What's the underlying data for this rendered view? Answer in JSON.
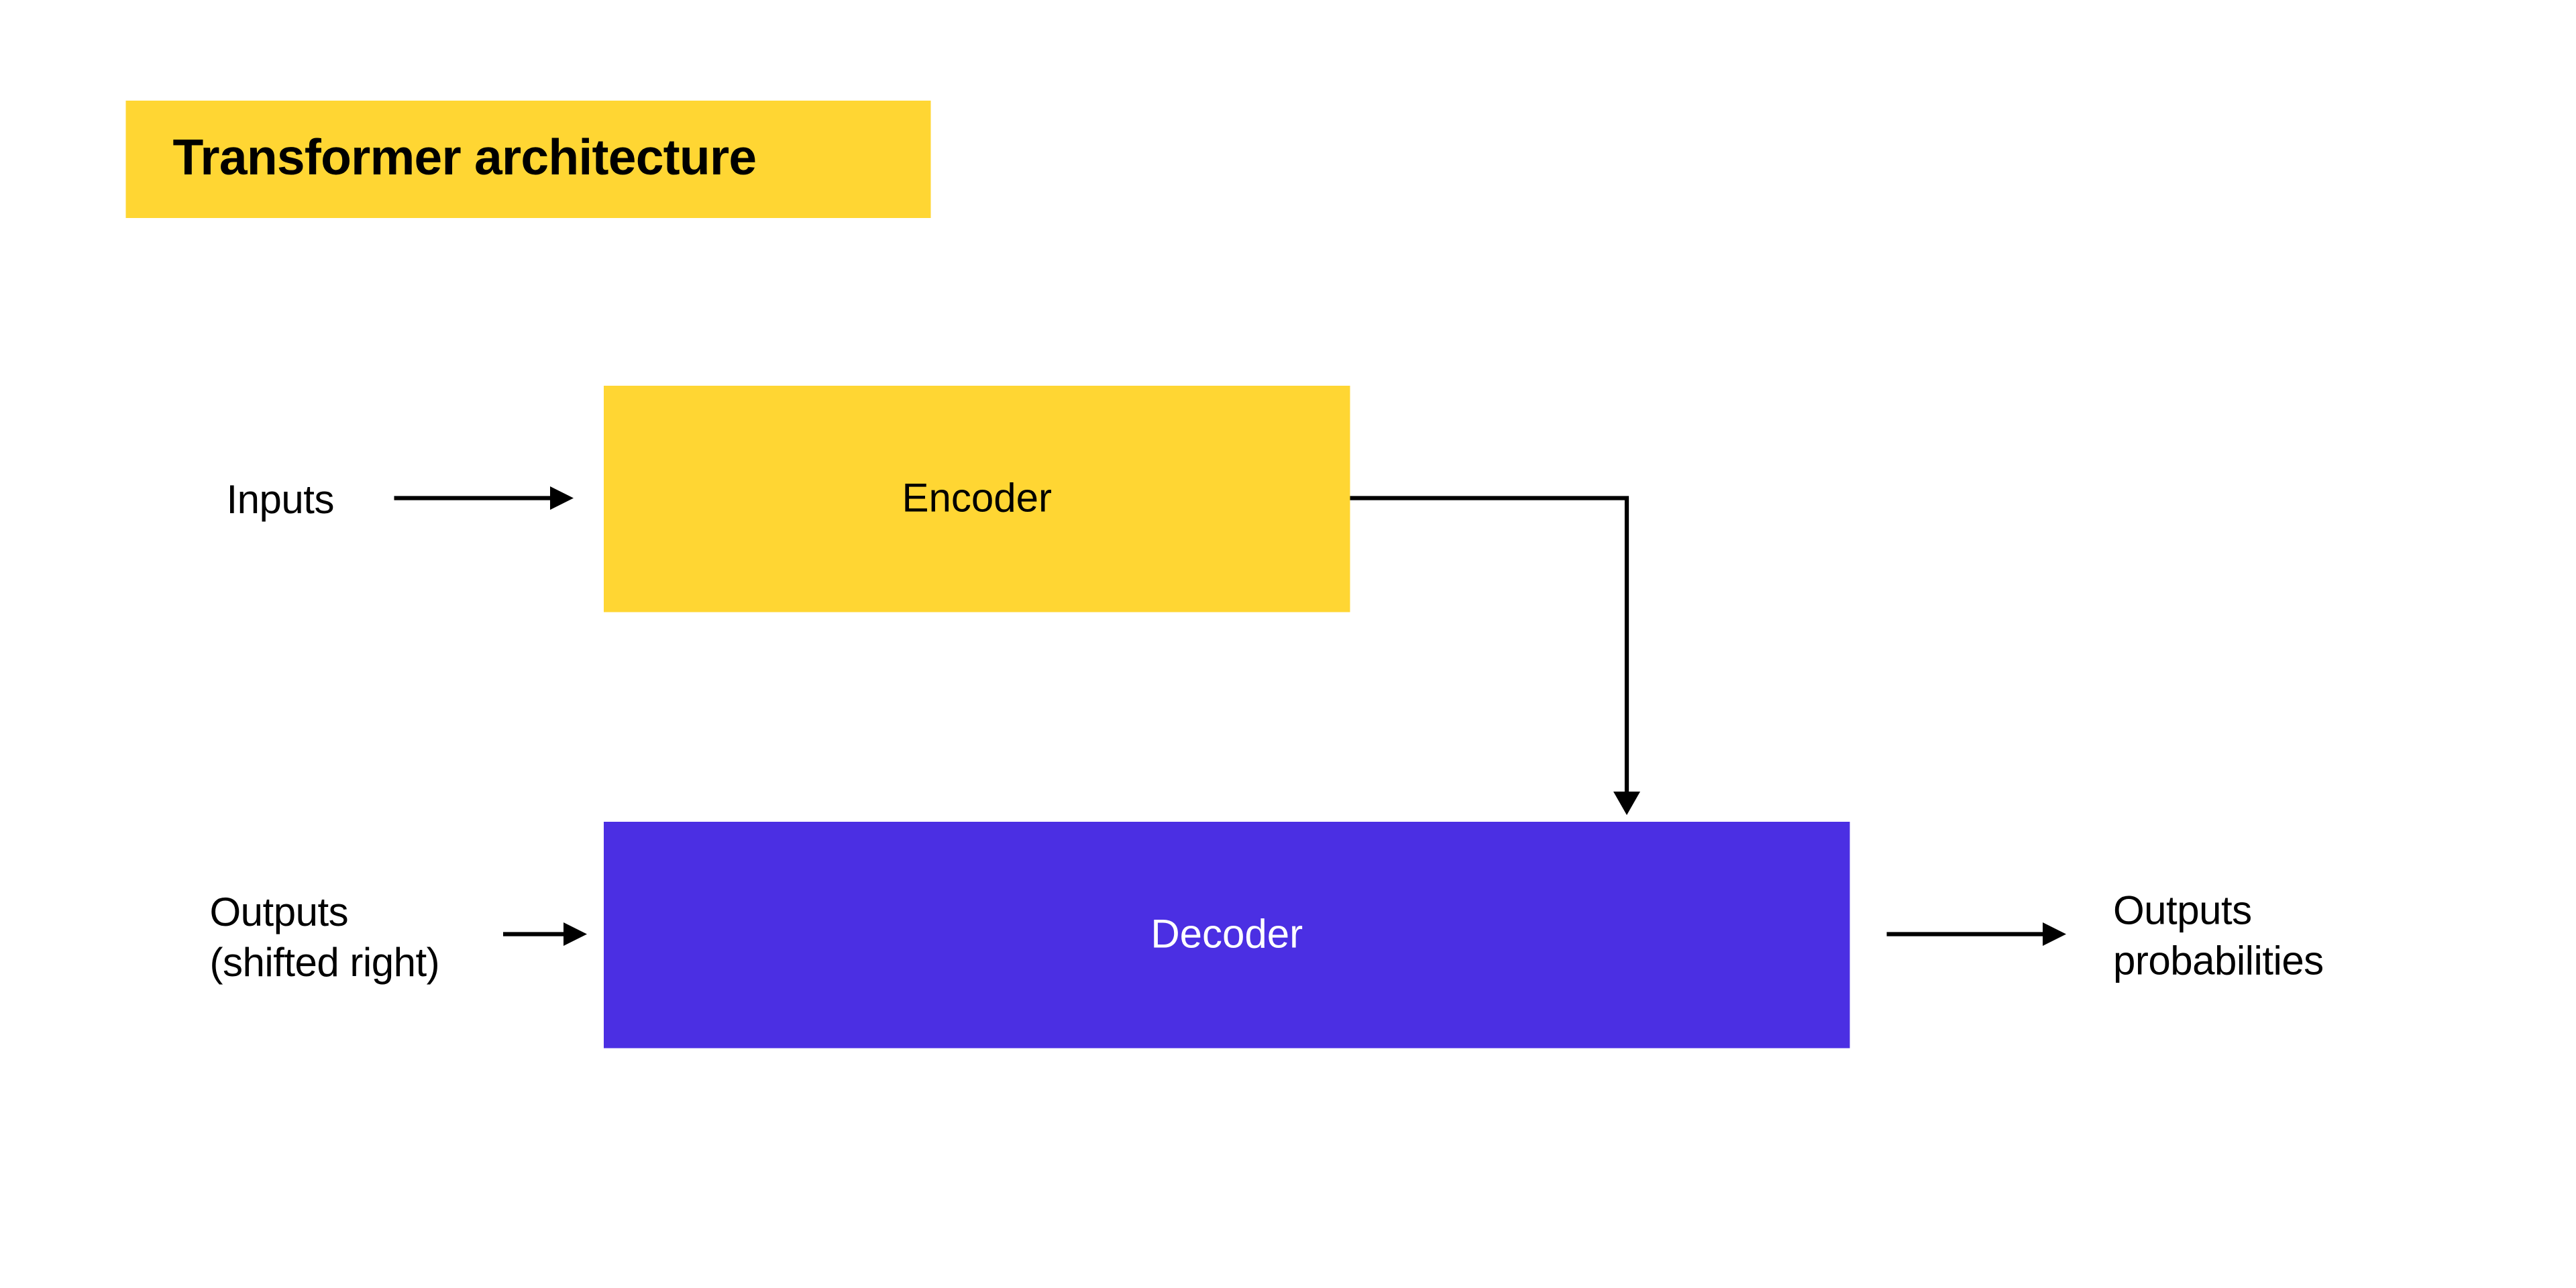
{
  "title": "Transformer architecture",
  "labels": {
    "inputs": "Inputs",
    "outputs_shifted_line1": "Outputs",
    "outputs_shifted_line2": "(shifted right)",
    "outputs_prob_line1": "Outputs",
    "outputs_prob_line2": "probabilities"
  },
  "blocks": {
    "encoder": "Encoder",
    "decoder": "Decoder"
  },
  "colors": {
    "yellow": "#ffd633",
    "purple": "#4b2fe3",
    "text": "#000000",
    "decoder_text": "#ffffff",
    "bg": "#ffffff"
  }
}
